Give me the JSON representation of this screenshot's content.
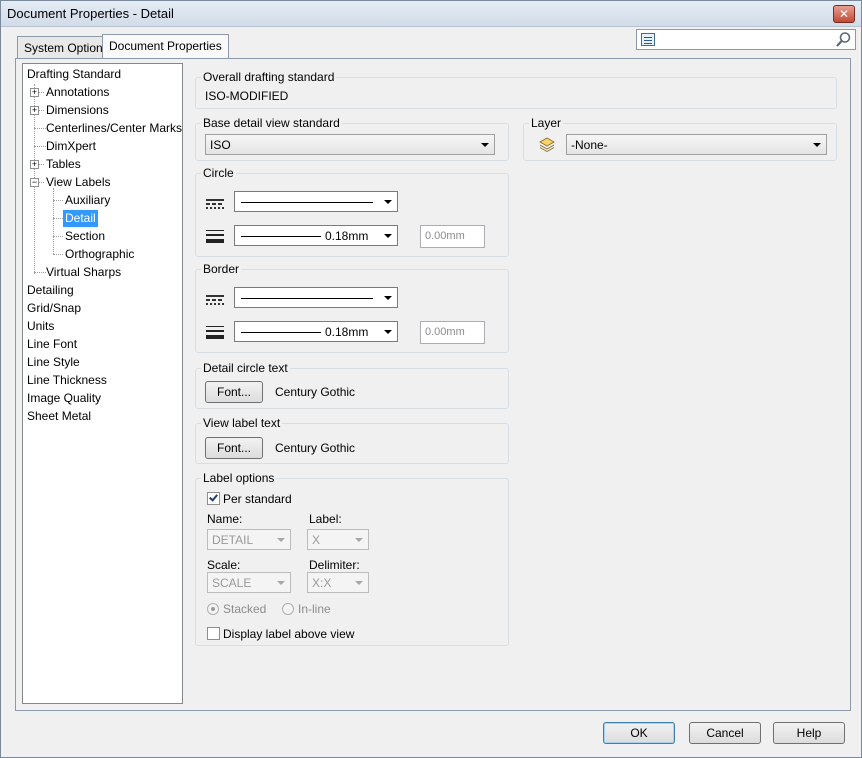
{
  "window": {
    "title": "Document Properties - Detail",
    "close": "✕"
  },
  "tabs": [
    "System Options",
    "Document Properties"
  ],
  "tree": [
    {
      "label": "Drafting Standard"
    },
    {
      "label": "Annotations"
    },
    {
      "label": "Dimensions"
    },
    {
      "label": "Centerlines/Center Marks"
    },
    {
      "label": "DimXpert"
    },
    {
      "label": "Tables"
    },
    {
      "label": "View Labels"
    },
    {
      "label": "Auxiliary"
    },
    {
      "label": "Detail"
    },
    {
      "label": "Section"
    },
    {
      "label": "Orthographic"
    },
    {
      "label": "Virtual Sharps"
    },
    {
      "label": "Detailing"
    },
    {
      "label": "Grid/Snap"
    },
    {
      "label": "Units"
    },
    {
      "label": "Line Font"
    },
    {
      "label": "Line Style"
    },
    {
      "label": "Line Thickness"
    },
    {
      "label": "Image Quality"
    },
    {
      "label": "Sheet Metal"
    }
  ],
  "overall": {
    "title": "Overall drafting standard",
    "value": "ISO-MODIFIED"
  },
  "base": {
    "title": "Base detail view standard",
    "value": "ISO"
  },
  "layer": {
    "title": "Layer",
    "value": "-None-"
  },
  "circle": {
    "title": "Circle",
    "thickness": "0.18mm",
    "custom": "0.00mm"
  },
  "border": {
    "title": "Border",
    "thickness": "0.18mm",
    "custom": "0.00mm"
  },
  "detail_text": {
    "title": "Detail circle text",
    "button": "Font...",
    "font": "Century Gothic"
  },
  "view_label_text": {
    "title": "View label text",
    "button": "Font...",
    "font": "Century Gothic"
  },
  "label_options": {
    "title": "Label options",
    "per_standard": "Per standard",
    "name_label": "Name:",
    "name_value": "DETAIL",
    "label_label": "Label:",
    "label_value": "X",
    "scale_label": "Scale:",
    "scale_value": "SCALE",
    "delimiter_label": "Delimiter:",
    "delimiter_value": "X:X",
    "stacked": "Stacked",
    "inline": "In-line",
    "display_above": "Display label above view"
  },
  "buttons": {
    "ok": "OK",
    "cancel": "Cancel",
    "help": "Help"
  }
}
